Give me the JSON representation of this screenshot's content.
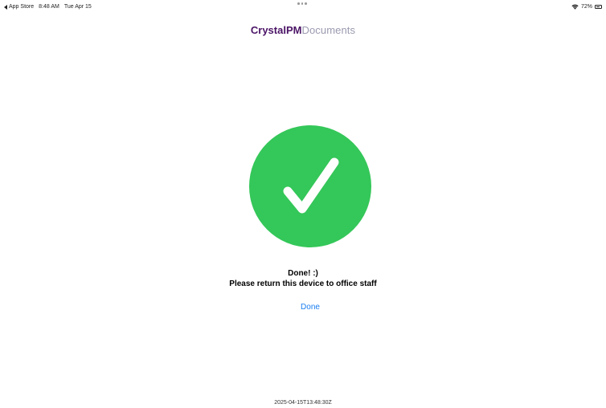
{
  "status_bar": {
    "back_app": "App Store",
    "time": "8:48 AM",
    "date": "Tue Apr 15",
    "battery": "72%",
    "battery_level": 0.72
  },
  "header": {
    "brand_strong": "CrystalPM",
    "brand_light": "Documents"
  },
  "success": {
    "icon": "checkmark-icon",
    "color": "#34c759"
  },
  "message": {
    "title": "Done! :)",
    "subtitle": "Please return this device to office staff"
  },
  "actions": {
    "done_label": "Done"
  },
  "footer": {
    "timestamp": "2025-04-15T13:48:30Z"
  },
  "colors": {
    "brand": "#4b1466",
    "brand_light": "#9a9ab0",
    "link": "#1a7ef0",
    "success": "#34c759"
  }
}
